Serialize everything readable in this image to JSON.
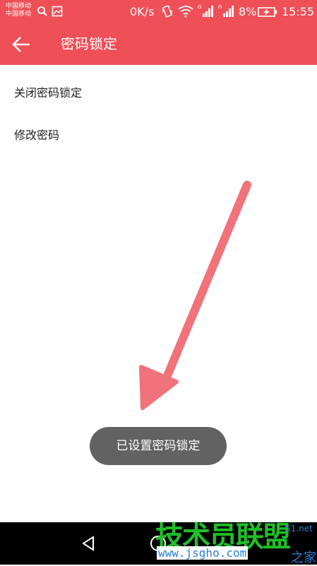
{
  "status_bar": {
    "carrier_1": "中国移动",
    "carrier_2": "中国移动",
    "net_speed": "0K/s",
    "battery": "8%",
    "time": "15:55"
  },
  "app_bar": {
    "title": "密码锁定"
  },
  "list": [
    {
      "label": "关闭密码锁定"
    },
    {
      "label": "修改密码"
    }
  ],
  "toast": {
    "message": "已设置密码锁定"
  },
  "watermark": {
    "logo": "技术员联盟",
    "url": "www.jsgho.com",
    "suffix": "51.net",
    "home": "之家"
  },
  "colors": {
    "accent": "#ef4f57",
    "toast_bg": "#626262",
    "annotation_arrow": "#f0727a"
  }
}
